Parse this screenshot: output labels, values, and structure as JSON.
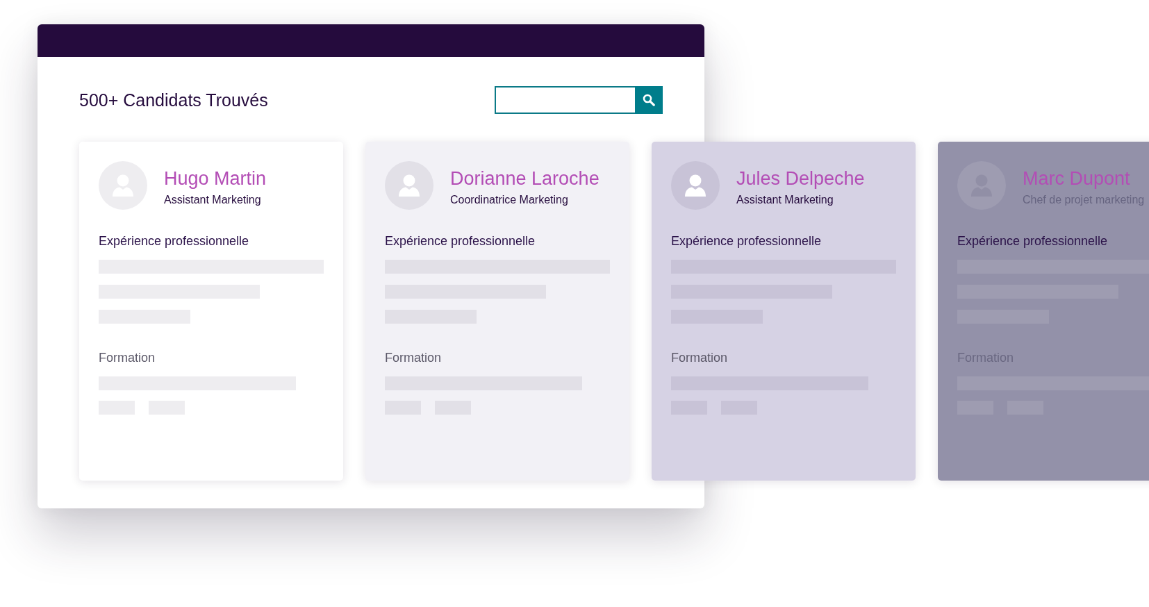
{
  "header": {
    "title": "500+ Candidats Trouvés"
  },
  "candidates": [
    {
      "name": "Hugo Martin",
      "job": "Assistant Marketing",
      "color": "#ffffff",
      "dimmed": false,
      "sections": [
        {
          "kind": "experience",
          "heading": "Expérience professionnelle"
        },
        {
          "kind": "education",
          "heading": "Formation"
        }
      ]
    },
    {
      "name": "Dorianne Laroche",
      "job": "Coordinatrice Marketing",
      "color": "#f2f1f6",
      "dimmed": false,
      "sections": [
        {
          "kind": "experience",
          "heading": "Expérience professionnelle"
        },
        {
          "kind": "education",
          "heading": "Formation"
        }
      ]
    },
    {
      "name": "Jules Delpeche",
      "job": "Assistant Marketing",
      "color": "#d6d2e4",
      "dimmed": false,
      "sections": [
        {
          "kind": "experience",
          "heading": "Expérience professionnelle"
        },
        {
          "kind": "education",
          "heading": "Formation"
        }
      ]
    },
    {
      "name": "Marc Dupont",
      "job": "Chef de projet marketing",
      "color": "#9391a9",
      "dimmed": true,
      "sections": [
        {
          "kind": "experience",
          "heading": "Expérience professionnelle"
        },
        {
          "kind": "education",
          "heading": "Formation"
        }
      ]
    }
  ]
}
